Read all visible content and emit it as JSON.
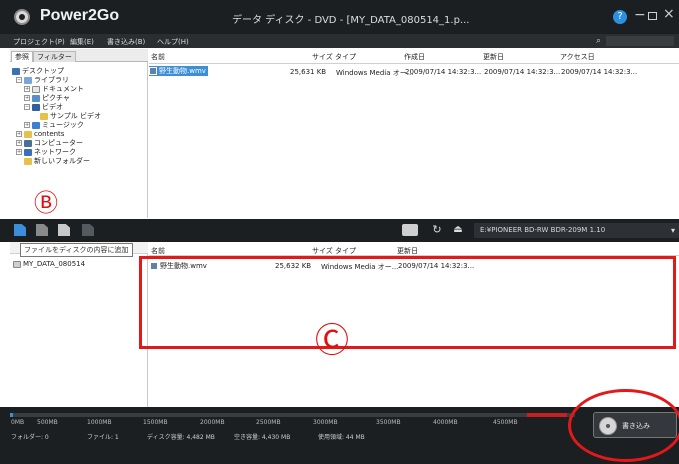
{
  "titlebar": {
    "app_name": "Power2Go",
    "window_title": "データ ディスク - DVD - [MY_DATA_080514_1.p...",
    "help_icon": "?",
    "minimize_icon": "−",
    "close_icon": "×"
  },
  "menubar": {
    "items": [
      "プロジェクト(P)",
      "編集(E)",
      "書き込み(B)",
      "ヘルプ(H)"
    ]
  },
  "tree": {
    "tabs": [
      "参照",
      "フィルター"
    ],
    "nodes": [
      "デスクトップ",
      "ライブラリ",
      "ドキュメント",
      "ピクチャ",
      "ビデオ",
      "サンプル ビデオ",
      "ミュージック",
      "contents",
      "コンピューター",
      "ネットワーク",
      "新しいフォルダー"
    ]
  },
  "files": {
    "headers": [
      "名前",
      "サイズ",
      "タイプ",
      "作成日",
      "更新日",
      "アクセス日"
    ],
    "rows": [
      {
        "name": "野生動物.wmv",
        "size": "25,631 KB",
        "type": "Windows Media オー...",
        "created": "2009/07/14 14:32:3...",
        "modified": "2009/07/14 14:32:3...",
        "accessed": "2009/07/14 14:32:3..."
      }
    ]
  },
  "toolbar": {
    "drive": "E:¥PIONEER BD-RW BDR-209M 1.10",
    "drive_arrow": "▾"
  },
  "annotations": {
    "b": "Ⓑ",
    "c": "Ⓒ"
  },
  "disc": {
    "tooltip": "ファイルをディスクの内容に追加",
    "volume": "MY_DATA_080514",
    "headers": [
      "名前",
      "サイズ",
      "タイプ",
      "更新日"
    ],
    "rows": [
      {
        "name": "野生動物.wmv",
        "size": "25,632 KB",
        "type": "Windows Media オー...",
        "modified": "2009/07/14 14:32:3..."
      }
    ]
  },
  "status": {
    "scale": [
      "0MB",
      "500MB",
      "1000MB",
      "1500MB",
      "2000MB",
      "2500MB",
      "3000MB",
      "3500MB",
      "4000MB",
      "4500MB"
    ],
    "used_fraction": 0.005,
    "folder_count": "フォルダー: 0",
    "file_count": "ファイル: 1",
    "disc_capacity": "ディスク容量: 4,482 MB",
    "free_capacity": "空き容量: 4,430 MB",
    "used_capacity": "使用領域: 44 MB",
    "burn_label": "書き込み"
  },
  "colors": {
    "accent": "#3b8ed8",
    "annotation_red": "#e31818",
    "dark_chrome": "#1c1f22"
  }
}
